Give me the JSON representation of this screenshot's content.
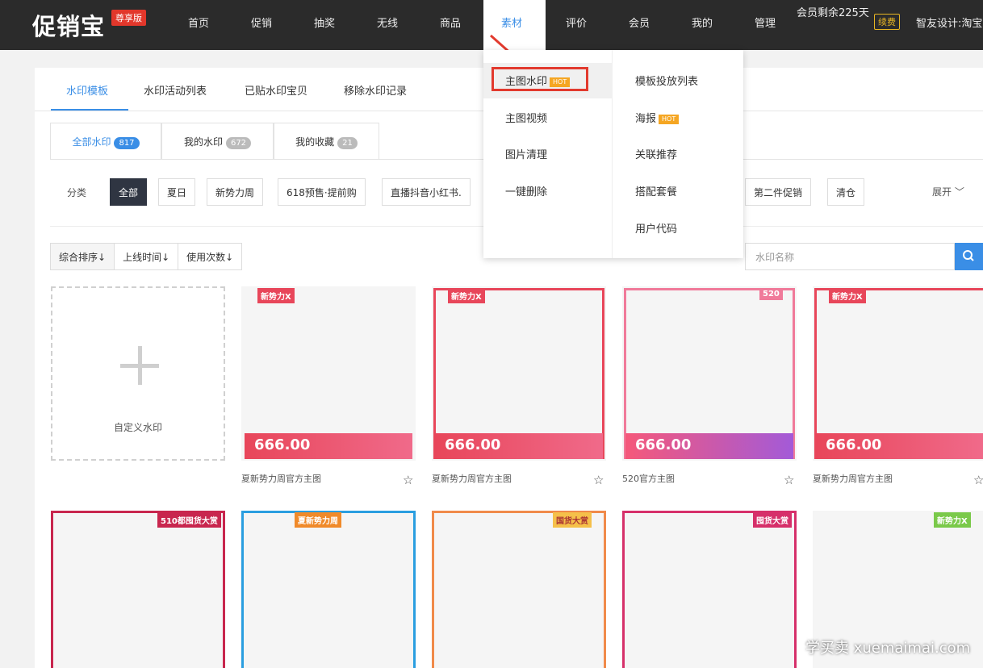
{
  "topbar": {
    "logo": "促销宝",
    "edition": "尊享版",
    "nav": [
      "首页",
      "促销",
      "抽奖",
      "无线",
      "商品",
      "素材",
      "评价",
      "会员",
      "我的",
      "管理"
    ],
    "active_nav": "素材",
    "member_days": "会员剩余225天",
    "renew": "续费",
    "shop": "智友设计:淘宝"
  },
  "dropdown": {
    "left": [
      {
        "label": "主图水印",
        "hot": true
      },
      {
        "label": "主图视频"
      },
      {
        "label": "图片清理"
      },
      {
        "label": "一键删除"
      }
    ],
    "right": [
      {
        "label": "模板投放列表"
      },
      {
        "label": "海报",
        "hot": true
      },
      {
        "label": "关联推荐"
      },
      {
        "label": "搭配套餐"
      },
      {
        "label": "用户代码"
      }
    ],
    "hot_label": "HOT"
  },
  "tabs_primary": [
    "水印模板",
    "水印活动列表",
    "已贴水印宝贝",
    "移除水印记录"
  ],
  "tabs_secondary": [
    {
      "label": "全部水印",
      "count": "817"
    },
    {
      "label": "我的水印",
      "count": "672"
    },
    {
      "label": "我的收藏",
      "count": "21"
    }
  ],
  "category": {
    "label": "分类",
    "chips": [
      "全部",
      "夏日",
      "新势力周",
      "618预售·提前购",
      "直播抖音小红书.",
      "第二件促销",
      "清仓"
    ],
    "expand": "展开"
  },
  "sort": [
    "综合排序↓",
    "上线时间↓",
    "使用次数↓"
  ],
  "search": {
    "placeholder": "水印名称"
  },
  "custom_label": "自定义水印",
  "cards": [
    {
      "badge": "新势力X",
      "price": "666.00",
      "caption": "夏新势力周官方主图",
      "color": "#e8465a"
    },
    {
      "badge": "新势力X",
      "price": "666.00",
      "caption": "夏新势力周官方主图",
      "color": "#e8465a"
    },
    {
      "badge": "520",
      "price": "666.00",
      "caption": "520官方主图",
      "color": "#f07a9a"
    },
    {
      "badge": "新势力X",
      "price": "666.00",
      "caption": "夏新势力周官方主图",
      "color": "#e8465a"
    }
  ],
  "cards_row2": [
    {
      "badge": "510都囤货大赏",
      "color": "#c8264e"
    },
    {
      "badge": "夏新势力周",
      "color": "#2a9ee0"
    },
    {
      "badge": "国货大赏",
      "color": "#f08a4a"
    },
    {
      "badge": "囤货大赏",
      "color": "#d6306a"
    },
    {
      "badge": "新势力X",
      "color": "#7ac94a"
    }
  ],
  "watermark": "学买卖 xuemaimai.com"
}
